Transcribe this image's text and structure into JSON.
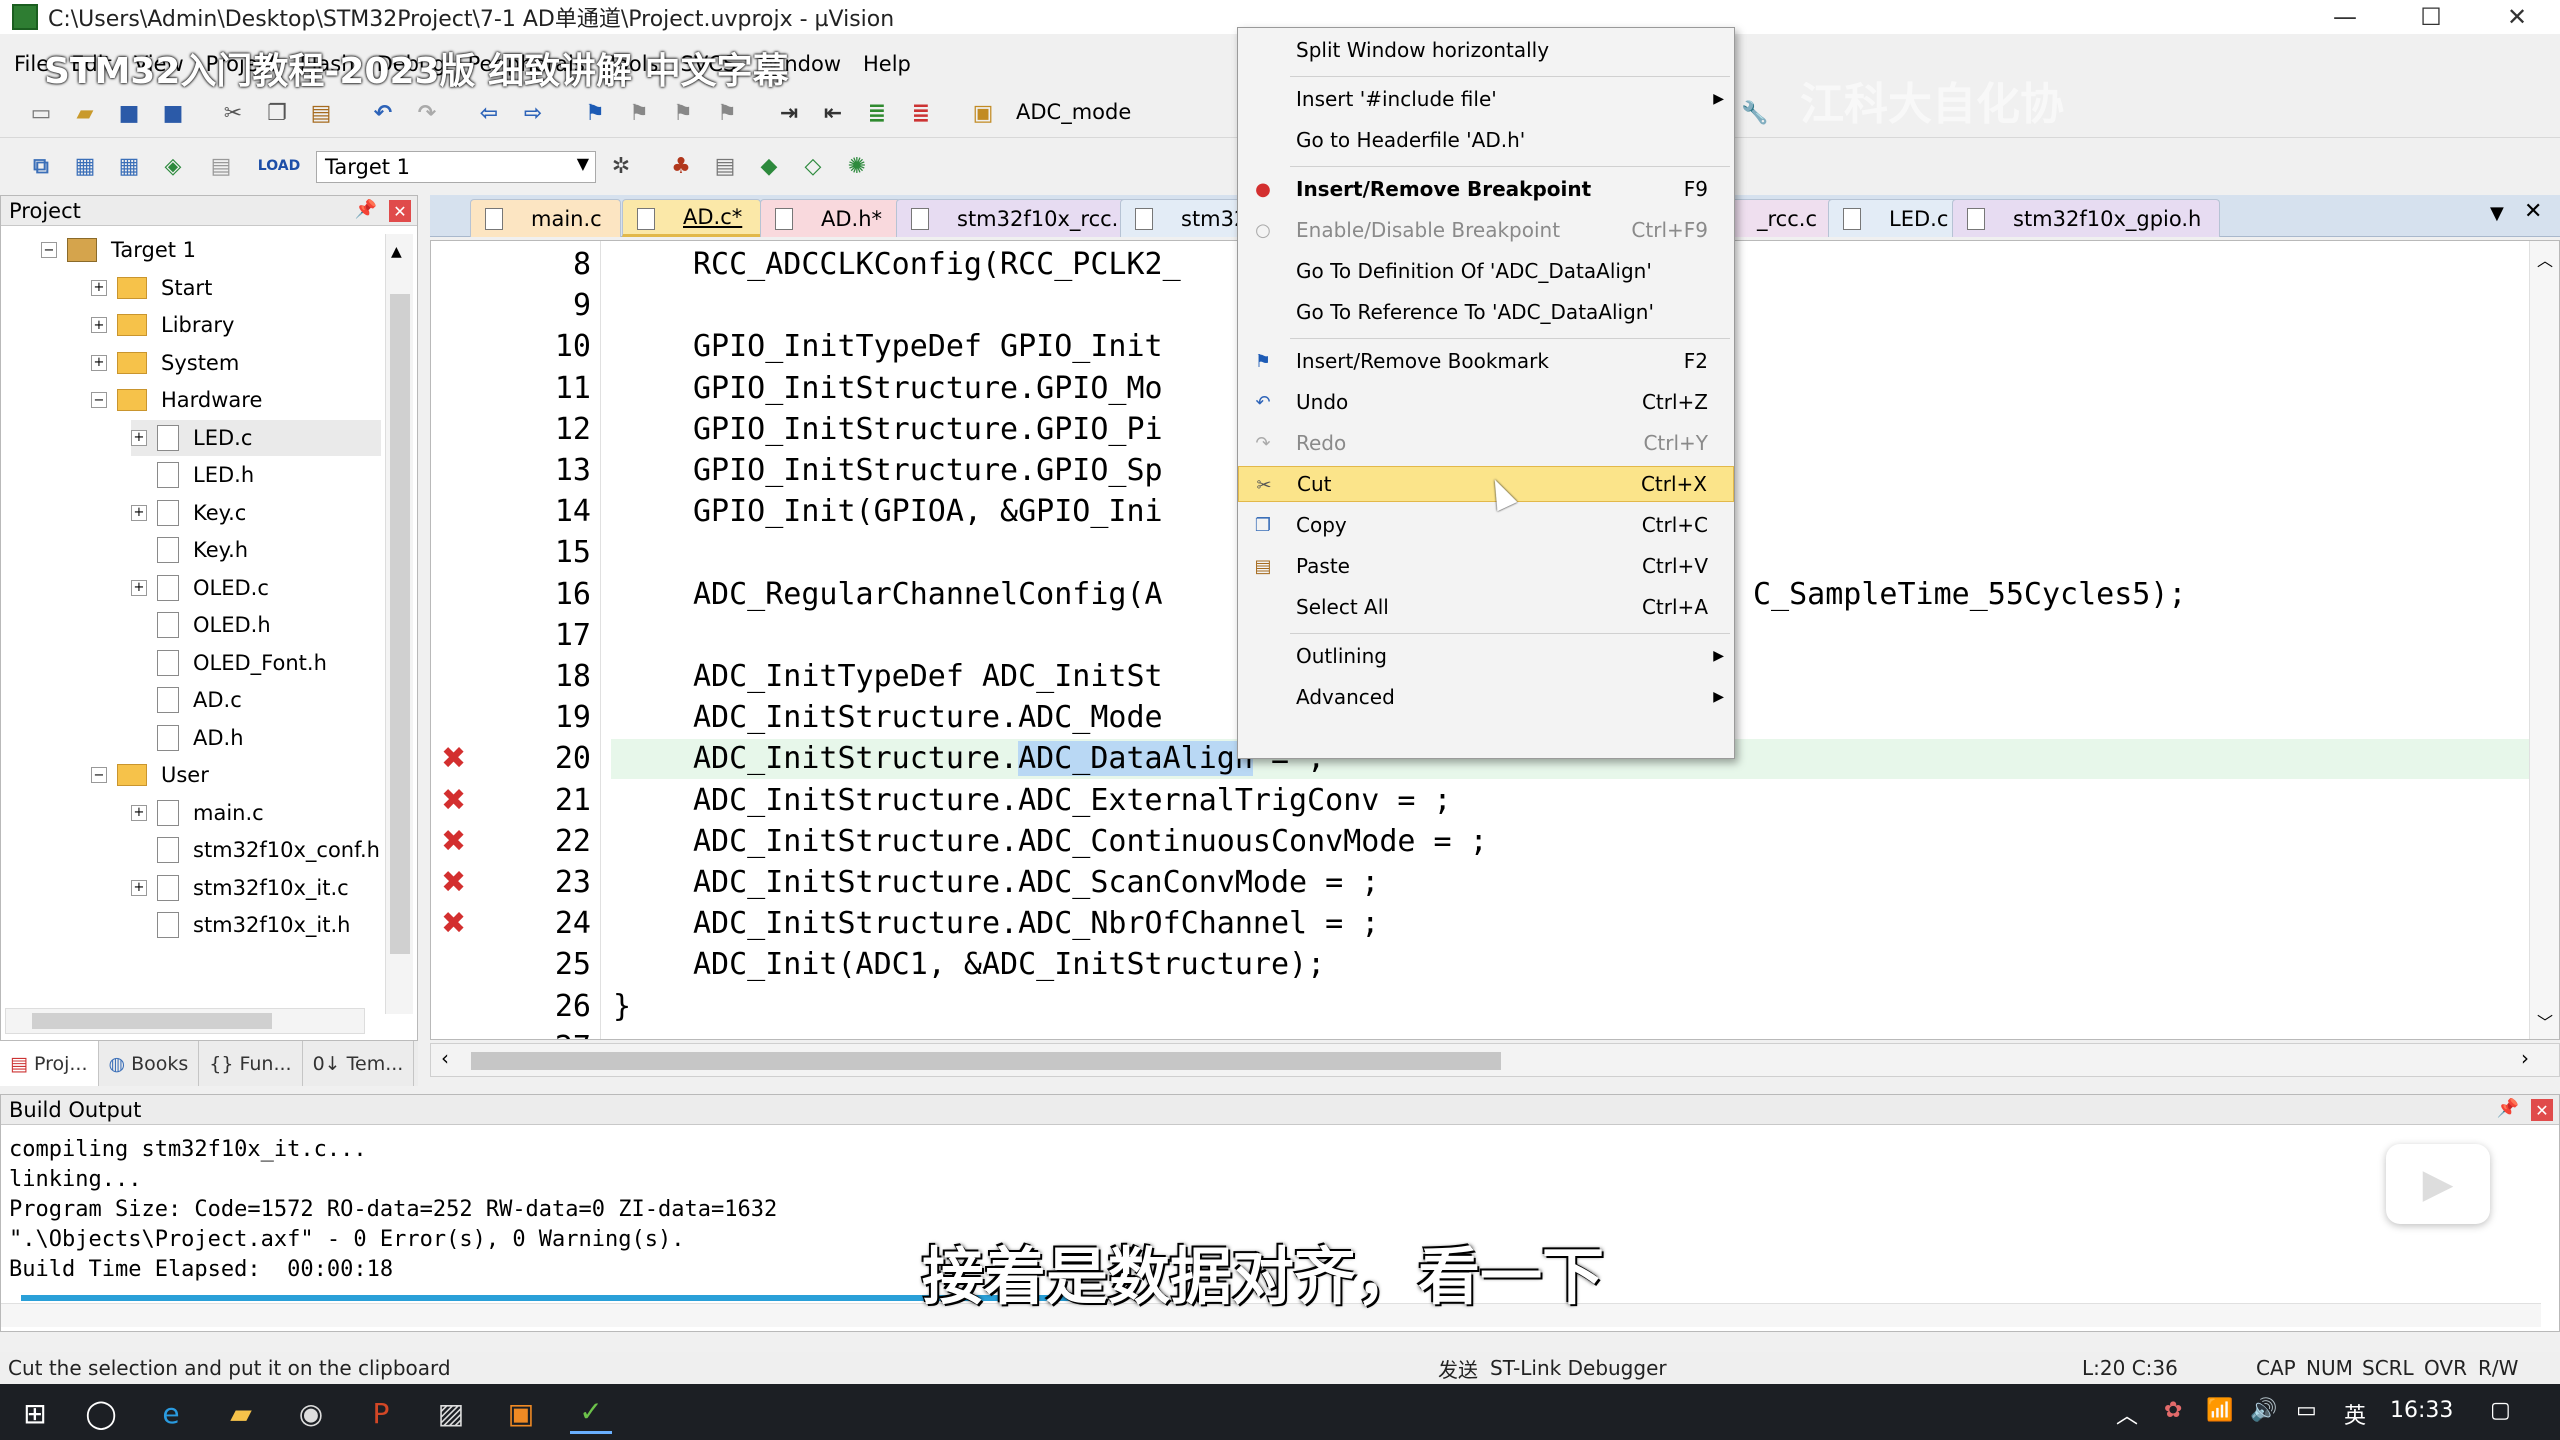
{
  "window": {
    "title": "C:\\Users\\Admin\\Desktop\\STM32Project\\7-1 AD单通道\\Project.uvprojx - µVision",
    "minimize": "—",
    "maximize": "☐",
    "close": "✕"
  },
  "overlay": {
    "video_title": "STM32入门教程-2023版 细致讲解 中文字幕",
    "watermark": "江科大自化协",
    "subtitle": "接着是数据对齐，看一下"
  },
  "menubar": [
    "File",
    "Edit",
    "View",
    "Project",
    "Flash",
    "Debug",
    "Peripherals",
    "Tools",
    "SVCS",
    "Window",
    "Help"
  ],
  "toolbar": {
    "combo1": "ADC_mode",
    "combo2": "Target 1"
  },
  "project_panel": {
    "title": "Project",
    "tree": [
      {
        "label": "Target 1",
        "level": 1,
        "kind": "target",
        "expander": "−"
      },
      {
        "label": "Start",
        "level": 2,
        "kind": "folder",
        "expander": "+"
      },
      {
        "label": "Library",
        "level": 2,
        "kind": "folder",
        "expander": "+"
      },
      {
        "label": "System",
        "level": 2,
        "kind": "folder",
        "expander": "+"
      },
      {
        "label": "Hardware",
        "level": 2,
        "kind": "folder",
        "expander": "−"
      },
      {
        "label": "LED.c",
        "level": 3,
        "kind": "file",
        "expander": "+"
      },
      {
        "label": "LED.h",
        "level": 3,
        "kind": "file",
        "expander": ""
      },
      {
        "label": "Key.c",
        "level": 3,
        "kind": "file",
        "expander": "+"
      },
      {
        "label": "Key.h",
        "level": 3,
        "kind": "file",
        "expander": ""
      },
      {
        "label": "OLED.c",
        "level": 3,
        "kind": "file",
        "expander": "+"
      },
      {
        "label": "OLED.h",
        "level": 3,
        "kind": "file",
        "expander": ""
      },
      {
        "label": "OLED_Font.h",
        "level": 3,
        "kind": "file",
        "expander": ""
      },
      {
        "label": "AD.c",
        "level": 3,
        "kind": "file",
        "expander": ""
      },
      {
        "label": "AD.h",
        "level": 3,
        "kind": "file",
        "expander": ""
      },
      {
        "label": "User",
        "level": 2,
        "kind": "folder",
        "expander": "−"
      },
      {
        "label": "main.c",
        "level": 3,
        "kind": "file",
        "expander": "+"
      },
      {
        "label": "stm32f10x_conf.h",
        "level": 3,
        "kind": "file",
        "expander": ""
      },
      {
        "label": "stm32f10x_it.c",
        "level": 3,
        "kind": "file",
        "expander": "+"
      },
      {
        "label": "stm32f10x_it.h",
        "level": 3,
        "kind": "file",
        "expander": ""
      }
    ],
    "tabs": [
      "Proj...",
      "Books",
      "{} Fun...",
      "0↓ Tem..."
    ]
  },
  "editor_tabs": [
    "main.c",
    "AD.c*",
    "AD.h*",
    "stm32f10x_rcc.h",
    "stm32f",
    "_rcc.c",
    "LED.c",
    "stm32f10x_gpio.h"
  ],
  "code_lines": [
    {
      "n": "8",
      "text": "RCC_ADCCLKConfig(RCC_PCLK2_",
      "err": false
    },
    {
      "n": "9",
      "text": "",
      "err": false
    },
    {
      "n": "10",
      "text": "GPIO_InitTypeDef GPIO_Init",
      "err": false
    },
    {
      "n": "11",
      "text": "GPIO_InitStructure.GPIO_Mo",
      "err": false
    },
    {
      "n": "12",
      "text": "GPIO_InitStructure.GPIO_Pi",
      "err": false
    },
    {
      "n": "13",
      "text": "GPIO_InitStructure.GPIO_Sp",
      "err": false
    },
    {
      "n": "14",
      "text": "GPIO_Init(GPIOA, &GPIO_Ini",
      "err": false
    },
    {
      "n": "15",
      "text": "",
      "err": false
    },
    {
      "n": "16",
      "text": "ADC_RegularChannelConfig(A",
      "tail": "C_SampleTime_55Cycles5);",
      "err": false
    },
    {
      "n": "17",
      "text": "",
      "err": false
    },
    {
      "n": "18",
      "text": "ADC_InitTypeDef ADC_InitSt",
      "err": false
    },
    {
      "n": "19",
      "text": "ADC_InitStructure.ADC_Mode",
      "err": false
    },
    {
      "n": "20",
      "pre": "ADC_InitStructure.",
      "sel": "ADC_DataAlign",
      "post": " = ;",
      "err": true
    },
    {
      "n": "21",
      "text": "ADC_InitStructure.ADC_ExternalTrigConv = ;",
      "err": true
    },
    {
      "n": "22",
      "text": "ADC_InitStructure.ADC_ContinuousConvMode = ;",
      "err": true
    },
    {
      "n": "23",
      "text": "ADC_InitStructure.ADC_ScanConvMode = ;",
      "err": true
    },
    {
      "n": "24",
      "text": "ADC_InitStructure.ADC_NbrOfChannel = ;",
      "err": true
    },
    {
      "n": "25",
      "text": "ADC_Init(ADC1, &ADC_InitStructure);",
      "err": false
    },
    {
      "n": "26",
      "text": "}",
      "err": false
    },
    {
      "n": "27",
      "text": "",
      "err": false
    }
  ],
  "context_menu": [
    {
      "label": "Split Window horizontally",
      "shortcut": "",
      "disabled": false
    },
    {
      "sep": true
    },
    {
      "label": "Insert '#include file'",
      "shortcut": "",
      "submenu": true
    },
    {
      "label": "Go to Headerfile 'AD.h'",
      "shortcut": ""
    },
    {
      "sep": true
    },
    {
      "label": "Insert/Remove Breakpoint",
      "shortcut": "F9",
      "bold": true,
      "icon": "breakpoint"
    },
    {
      "label": "Enable/Disable Breakpoint",
      "shortcut": "Ctrl+F9",
      "disabled": true,
      "icon": "breakpoint-disabled"
    },
    {
      "label": "Go To Definition Of 'ADC_DataAlign'",
      "shortcut": ""
    },
    {
      "label": "Go To Reference To 'ADC_DataAlign'",
      "shortcut": ""
    },
    {
      "sep": true
    },
    {
      "label": "Insert/Remove Bookmark",
      "shortcut": "F2",
      "icon": "bookmark"
    },
    {
      "label": "Undo",
      "shortcut": "Ctrl+Z",
      "icon": "undo"
    },
    {
      "label": "Redo",
      "shortcut": "Ctrl+Y",
      "disabled": true,
      "icon": "redo"
    },
    {
      "label": "Cut",
      "shortcut": "Ctrl+X",
      "hot": true,
      "icon": "cut"
    },
    {
      "label": "Copy",
      "shortcut": "Ctrl+C",
      "icon": "copy"
    },
    {
      "label": "Paste",
      "shortcut": "Ctrl+V",
      "icon": "paste"
    },
    {
      "label": "Select All",
      "shortcut": "Ctrl+A"
    },
    {
      "sep": true
    },
    {
      "label": "Outlining",
      "shortcut": "",
      "submenu": true
    },
    {
      "label": "Advanced",
      "shortcut": "",
      "submenu": true
    }
  ],
  "build_output": {
    "title": "Build Output",
    "lines": [
      "compiling stm32f10x_it.c...",
      "linking...",
      "Program Size: Code=1572 RO-data=252 RW-data=0 ZI-data=1632",
      "\".\\Objects\\Project.axf\" - 0 Error(s), 0 Warning(s).",
      "Build Time Elapsed:  00:00:18"
    ]
  },
  "statusbar": {
    "hint": "Cut the selection and put it on the clipboard",
    "send": "发送",
    "debugger": "ST-Link Debugger",
    "position": "L:20 C:36",
    "indicators": [
      "CAP",
      "NUM",
      "SCRL",
      "OVR",
      "R/W"
    ]
  },
  "taskbar": {
    "time": "16:33",
    "ime": "英"
  },
  "colors": {
    "accent": "#fbe48a",
    "selection": "#b9d8f4",
    "error": "#d32f2f",
    "current_line": "#e7f7ea"
  }
}
